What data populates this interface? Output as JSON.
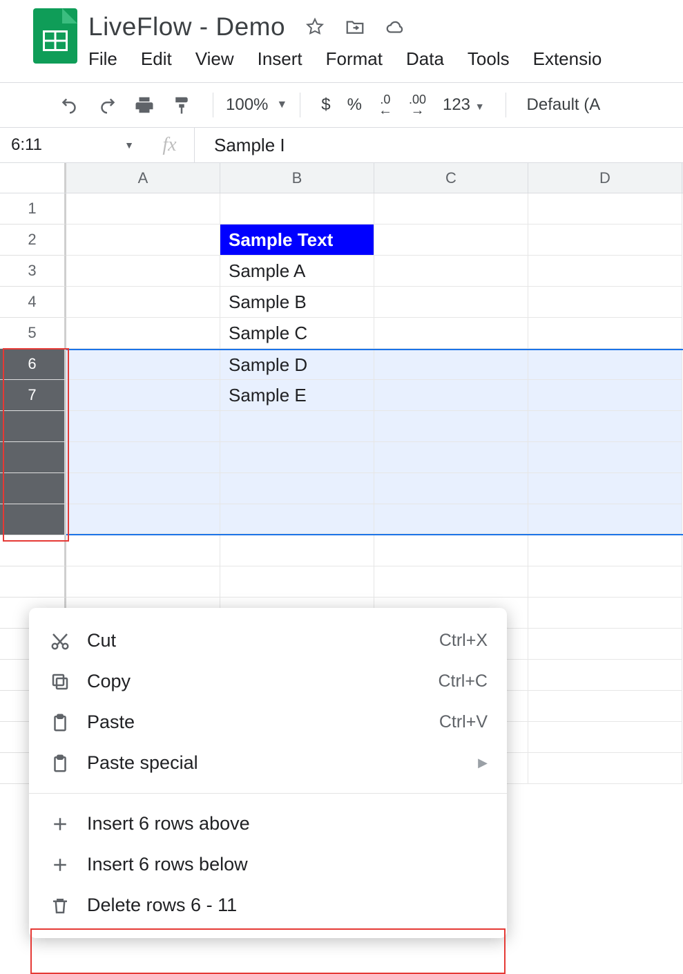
{
  "doc": {
    "title": "LiveFlow - Demo"
  },
  "menubar": {
    "file": "File",
    "edit": "Edit",
    "view": "View",
    "insert": "Insert",
    "format": "Format",
    "data": "Data",
    "tools": "Tools",
    "extensions": "Extensio"
  },
  "toolbar": {
    "zoom": "100%",
    "currency": "$",
    "percent": "%",
    "dec_decrease": ".0",
    "dec_increase": ".00",
    "numfmt": "123",
    "font": "Default (A"
  },
  "namebox": {
    "value": "6:11"
  },
  "formula_bar": {
    "value": "Sample I"
  },
  "columns": [
    "A",
    "B",
    "C",
    "D"
  ],
  "rows": {
    "r1": {
      "num": "1"
    },
    "r2": {
      "num": "2",
      "B": "Sample Text"
    },
    "r3": {
      "num": "3",
      "B": "Sample A"
    },
    "r4": {
      "num": "4",
      "B": "Sample B"
    },
    "r5": {
      "num": "5",
      "B": "Sample C"
    },
    "r6": {
      "num": "6",
      "B": "Sample D"
    },
    "r7": {
      "num": "7",
      "B": "Sample E"
    }
  },
  "context_menu": {
    "cut": {
      "label": "Cut",
      "shortcut": "Ctrl+X"
    },
    "copy": {
      "label": "Copy",
      "shortcut": "Ctrl+C"
    },
    "paste": {
      "label": "Paste",
      "shortcut": "Ctrl+V"
    },
    "paste_special": {
      "label": "Paste special"
    },
    "insert_above": {
      "label": "Insert 6 rows above"
    },
    "insert_below": {
      "label": "Insert 6 rows below"
    },
    "delete_rows": {
      "label": "Delete rows 6 - 11"
    }
  }
}
